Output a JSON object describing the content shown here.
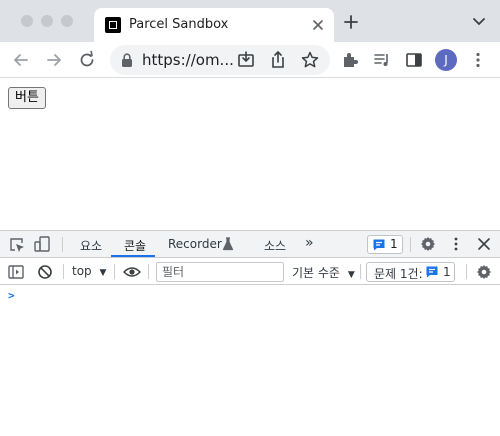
{
  "browser": {
    "tab": {
      "title": "Parcel Sandbox",
      "favicon": "parcel-sandbox-icon"
    },
    "address": {
      "url": "https://om..."
    },
    "profile": {
      "initial": "J",
      "color": "#5c6bc0"
    },
    "toolbar_icons": [
      "back-icon",
      "forward-icon",
      "reload-icon",
      "lock-icon",
      "install-icon",
      "share-icon",
      "bookmark-star-icon",
      "extensions-icon",
      "media-control-icon",
      "side-panel-icon",
      "more-icon"
    ]
  },
  "page": {
    "button_label": "버튼"
  },
  "devtools": {
    "tabs": [
      {
        "label": "요소",
        "active": false
      },
      {
        "label": "콘솔",
        "active": true
      },
      {
        "label": "Recorder",
        "active": false
      },
      {
        "label": "소스",
        "active": false
      }
    ],
    "more_tabs_glyph": "»",
    "message_badge_count": "1",
    "console": {
      "context": "top",
      "filter_placeholder": "필터",
      "level": "기본 수준",
      "issues_label": "문제 1건:",
      "issues_count": "1",
      "prompt": ">"
    },
    "accent_color": "#1a73e8"
  }
}
